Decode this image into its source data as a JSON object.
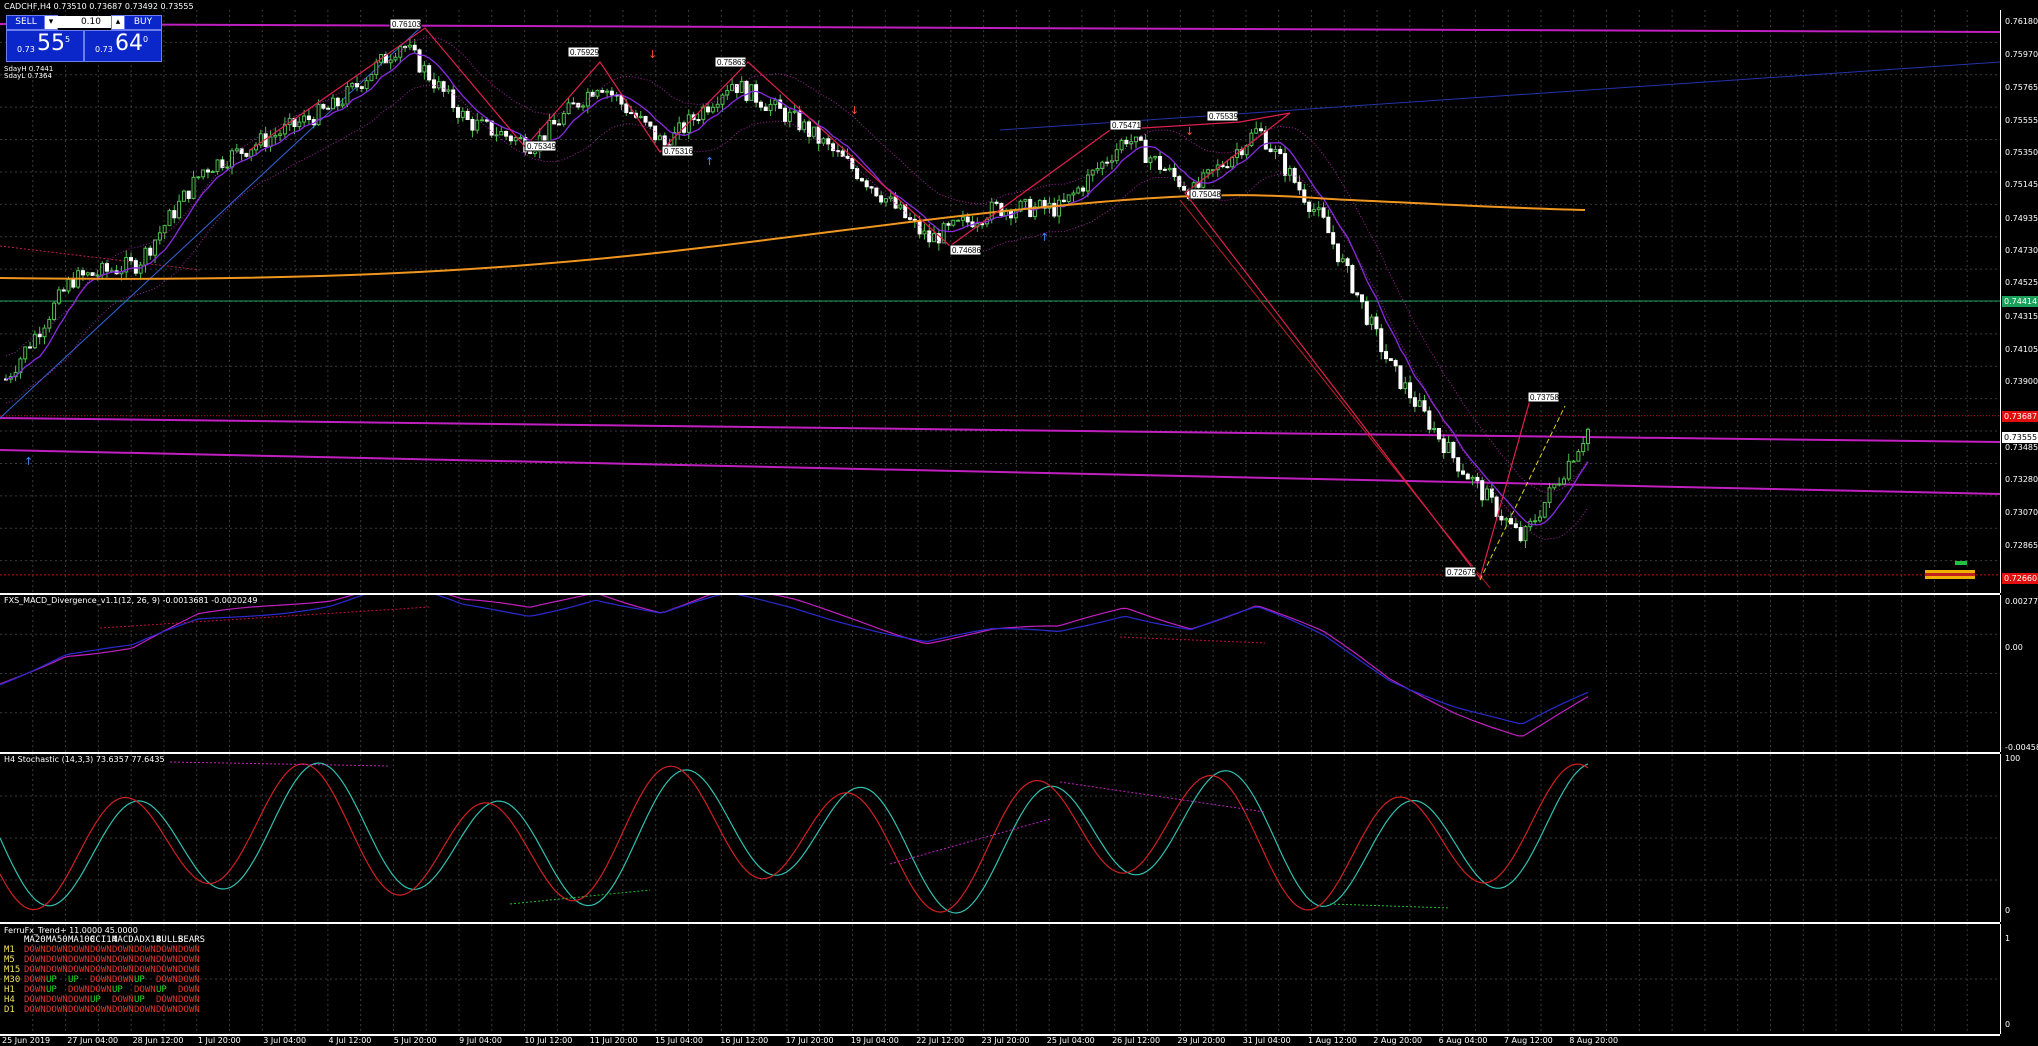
{
  "header": {
    "symbol_line": "CADCHF,H4  0.73510 0.73687 0.73492 0.73555"
  },
  "trade_panel": {
    "sell_label": "SELL",
    "buy_label": "BUY",
    "lot": "0.10",
    "sell_prefix": "0.73",
    "sell_big": "55",
    "sell_sup": "5",
    "buy_prefix": "0.73",
    "buy_big": "64",
    "buy_sup": "0"
  },
  "info_lines": [
    "SdayH 0.7441",
    "SdayL 0.7364"
  ],
  "price_axis": [
    "0.76180",
    "0.75970",
    "0.75765",
    "0.75555",
    "0.75350",
    "0.75145",
    "0.74935",
    "0.74730",
    "0.74525",
    "0.74315",
    "0.74105",
    "0.73900",
    "0.73690",
    "0.73485",
    "0.73280",
    "0.73070",
    "0.72865",
    "0.72660"
  ],
  "price_tags": [
    {
      "text": "0.74414",
      "bg": "#1aa05a"
    },
    {
      "text": "0.73687",
      "bg": "#e01010"
    },
    {
      "text": "0.73555",
      "bg": "#ffffff"
    },
    {
      "text": "0.72660",
      "bg": "#e01010"
    }
  ],
  "swing_labels": [
    "0.76103",
    "0.75929",
    "0.75863",
    "0.75349",
    "0.75316",
    "0.74686",
    "0.75471",
    "0.75539",
    "0.75048",
    "0.73758",
    "0.72679"
  ],
  "macd": {
    "title": "FXS_MACD_Divergence_v1.1(12, 26, 9) -0.0013681 -0.0020249",
    "axis": [
      "0.0027777",
      "0.00",
      "-0.004582"
    ]
  },
  "stoch": {
    "title": "H4 Stochastic (14,3,3) 73.6357 77.6435",
    "axis": [
      "100",
      "0"
    ]
  },
  "ferro": {
    "title": "FerruFx_Trend+ 11.0000 45.0000",
    "axis": [
      "1",
      "0"
    ],
    "columns": [
      "MA20",
      "MA50",
      "MA100",
      "CCI14",
      "MACD",
      "ADX14",
      "BULLS",
      "BEARS"
    ],
    "rows": [
      {
        "tf": "M1",
        "cells": [
          "DOWN",
          "DOWN",
          "DOWN",
          "DOWN",
          "DOWN",
          "DOWN",
          "DOWN",
          "DOWN"
        ]
      },
      {
        "tf": "M5",
        "cells": [
          "DOWN",
          "DOWN",
          "DOWN",
          "DOWN",
          "DOWN",
          "DOWN",
          "DOWN",
          "DOWN"
        ]
      },
      {
        "tf": "M15",
        "cells": [
          "DOWN",
          "DOWN",
          "DOWN",
          "DOWN",
          "DOWN",
          "DOWN",
          "DOWN",
          "DOWN"
        ]
      },
      {
        "tf": "M30",
        "cells": [
          "DOWN",
          "UP",
          "UP",
          "DOWN",
          "DOWN",
          "UP",
          "DOWN",
          "DOWN"
        ]
      },
      {
        "tf": "H1",
        "cells": [
          "DOWN",
          "UP",
          "DOWN",
          "DOWN",
          "UP",
          "DOWN",
          "UP",
          "DOWN"
        ]
      },
      {
        "tf": "H4",
        "cells": [
          "DOWN",
          "DOWN",
          "DOWN",
          "UP",
          "DOWN",
          "UP",
          "DOWN",
          "DOWN"
        ]
      },
      {
        "tf": "D1",
        "cells": [
          "DOWN",
          "DOWN",
          "DOWN",
          "DOWN",
          "DOWN",
          "DOWN",
          "DOWN",
          "DOWN"
        ]
      }
    ]
  },
  "time_axis": [
    "25 Jun 2019",
    "27 Jun 04:00",
    "28 Jun 12:00",
    "1 Jul 20:00",
    "3 Jul 04:00",
    "4 Jul 12:00",
    "5 Jul 20:00",
    "9 Jul 04:00",
    "10 Jul 12:00",
    "11 Jul 20:00",
    "15 Jul 04:00",
    "16 Jul 12:00",
    "17 Jul 20:00",
    "19 Jul 04:00",
    "22 Jul 12:00",
    "23 Jul 20:00",
    "25 Jul 04:00",
    "26 Jul 12:00",
    "29 Jul 20:00",
    "31 Jul 04:00",
    "1 Aug 12:00",
    "2 Aug 20:00",
    "6 Aug 04:00",
    "7 Aug 12:00",
    "8 Aug 20:00"
  ],
  "colors": {
    "bull_candle": "#ffffff",
    "bear_candle": "#4fc24f",
    "ma_orange": "#f0961e",
    "trend_magenta": "#d020d0",
    "macd_main": "#c020c0",
    "macd_signal": "#2020c0",
    "stoch_main": "#30c0b0",
    "stoch_signal": "#d02020"
  },
  "chart_data": [
    {
      "type": "line",
      "title": "CADCHF,H4",
      "x": [
        "25 Jun 2019",
        "27 Jun 04:00",
        "28 Jun 12:00",
        "1 Jul 20:00",
        "3 Jul 04:00",
        "4 Jul 12:00",
        "5 Jul 20:00",
        "9 Jul 04:00",
        "10 Jul 12:00",
        "11 Jul 20:00",
        "15 Jul 04:00",
        "16 Jul 12:00",
        "17 Jul 20:00",
        "19 Jul 04:00",
        "22 Jul 12:00",
        "23 Jul 20:00",
        "25 Jul 04:00",
        "26 Jul 12:00",
        "29 Jul 20:00",
        "31 Jul 04:00",
        "1 Aug 12:00",
        "2 Aug 20:00",
        "6 Aug 04:00",
        "7 Aug 12:00",
        "8 Aug 20:00"
      ],
      "series": [
        {
          "values": [
            0.7392,
            0.7455,
            0.7465,
            0.7525,
            0.7545,
            0.7565,
            0.7605,
            0.7555,
            0.754,
            0.758,
            0.754,
            0.758,
            0.7555,
            0.752,
            0.748,
            0.75,
            0.75,
            0.7545,
            0.751,
            0.755,
            0.749,
            0.74,
            0.734,
            0.729,
            0.736
          ]
        }
      ],
      "ylim": [
        0.7266,
        0.7618
      ]
    }
  ]
}
